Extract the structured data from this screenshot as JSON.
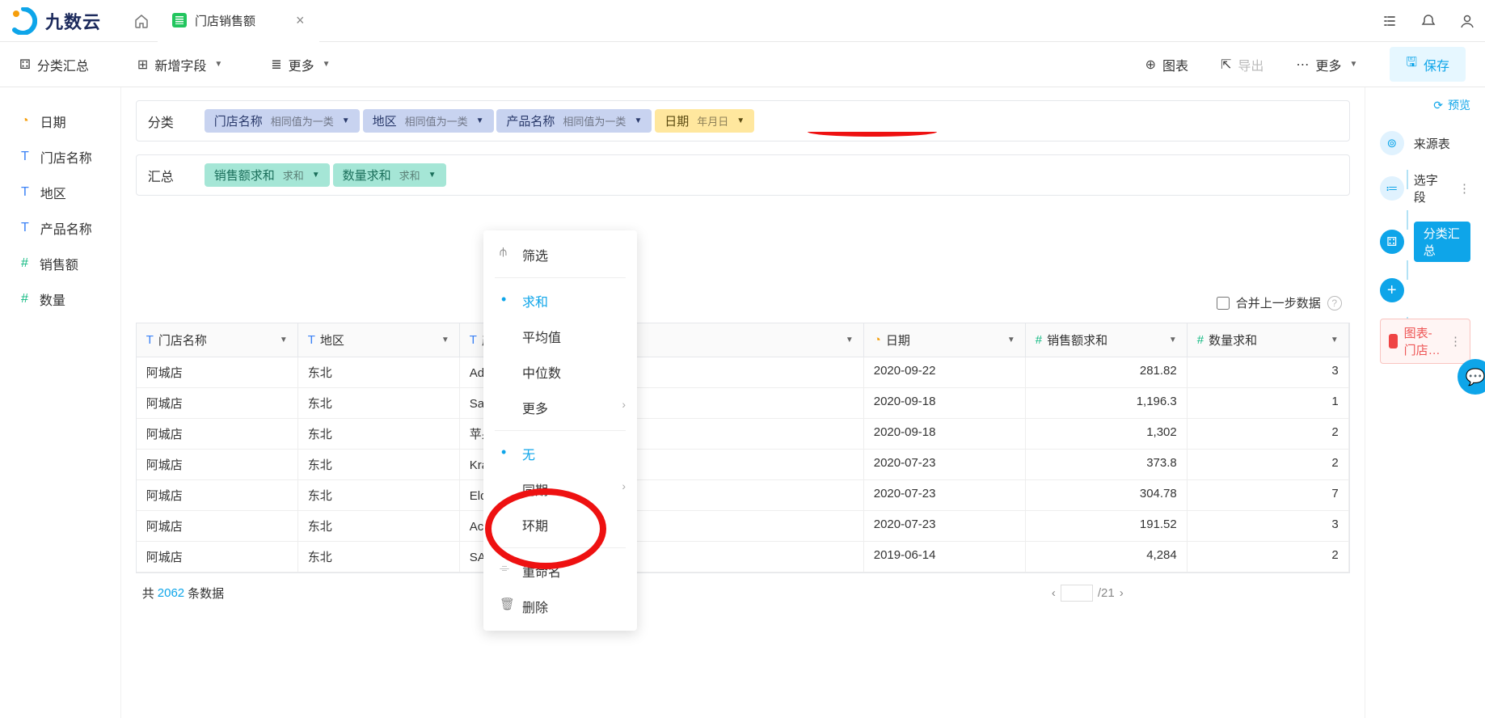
{
  "brand": {
    "name": "九数云"
  },
  "tab": {
    "title": "门店销售额"
  },
  "toolbar": {
    "group": "分类汇总",
    "new_field": "新增字段",
    "more": "更多",
    "chart": "图表",
    "export": "导出",
    "save": "保存"
  },
  "fields": {
    "date": "日期",
    "store": "门店名称",
    "region": "地区",
    "product": "产品名称",
    "sales": "销售额",
    "qty": "数量"
  },
  "config": {
    "section_group": "分类",
    "section_agg": "汇总",
    "pills_group": [
      {
        "label": "门店名称",
        "hint": "相同值为一类",
        "cls": "pill-blue"
      },
      {
        "label": "地区",
        "hint": "相同值为一类",
        "cls": "pill-blue"
      },
      {
        "label": "产品名称",
        "hint": "相同值为一类",
        "cls": "pill-blue"
      },
      {
        "label": "日期",
        "hint": "年月日",
        "cls": "pill-yellow"
      }
    ],
    "pills_agg": [
      {
        "label": "销售额求和",
        "hint": "求和",
        "cls": "pill-green"
      },
      {
        "label": "数量求和",
        "hint": "求和",
        "cls": "pill-green"
      }
    ],
    "merge_label": "合并上一步数据"
  },
  "dropdown": {
    "filter": "筛选",
    "sum": "求和",
    "avg": "平均值",
    "median": "中位数",
    "more": "更多",
    "none": "无",
    "yoy": "同期",
    "mom": "环期",
    "rename": "重命名",
    "delete": "删除"
  },
  "table": {
    "headers": {
      "store": "门店名称",
      "region": "地区",
      "product": "产品名称",
      "date": "日期",
      "sales": "销售额求和",
      "qty": "数量求和"
    },
    "rows": [
      {
        "store": "阿城店",
        "region": "东北",
        "product": "Advantus 灯泡, 一…",
        "date": "2020-09-22",
        "sales": "281.82",
        "qty": "3"
      },
      {
        "store": "阿城店",
        "region": "东北",
        "product": "SanDisk 路由器, …",
        "date": "2020-09-18",
        "sales": "1,196.3",
        "qty": "1"
      },
      {
        "store": "阿城店",
        "region": "东北",
        "product": "苹果 信号增强器, …",
        "date": "2020-09-18",
        "sales": "1,302",
        "qty": "2"
      },
      {
        "store": "阿城店",
        "region": "东北",
        "product": "Kraft 邮寄品, 银色…",
        "date": "2020-07-23",
        "sales": "373.8",
        "qty": "2"
      },
      {
        "store": "阿城店",
        "region": "东北",
        "product": "Eldon 盒, 金属",
        "date": "2020-07-23",
        "sales": "304.78",
        "qty": "7"
      },
      {
        "store": "阿城店",
        "region": "东北",
        "product": "Acco 装订机盖, 回…",
        "date": "2020-07-23",
        "sales": "191.52",
        "qty": "3"
      },
      {
        "store": "阿城店",
        "region": "东北",
        "product": "SAFCO 扶手椅, 黑…",
        "date": "2019-06-14",
        "sales": "4,284",
        "qty": "2"
      }
    ]
  },
  "pager": {
    "prefix": "共",
    "count": "2062",
    "suffix": "条数据",
    "page": "",
    "total": "/21"
  },
  "steps": {
    "preview": "预览",
    "source": "来源表",
    "select": "选字段",
    "group": "分类汇总",
    "chart": "图表-门店…"
  }
}
